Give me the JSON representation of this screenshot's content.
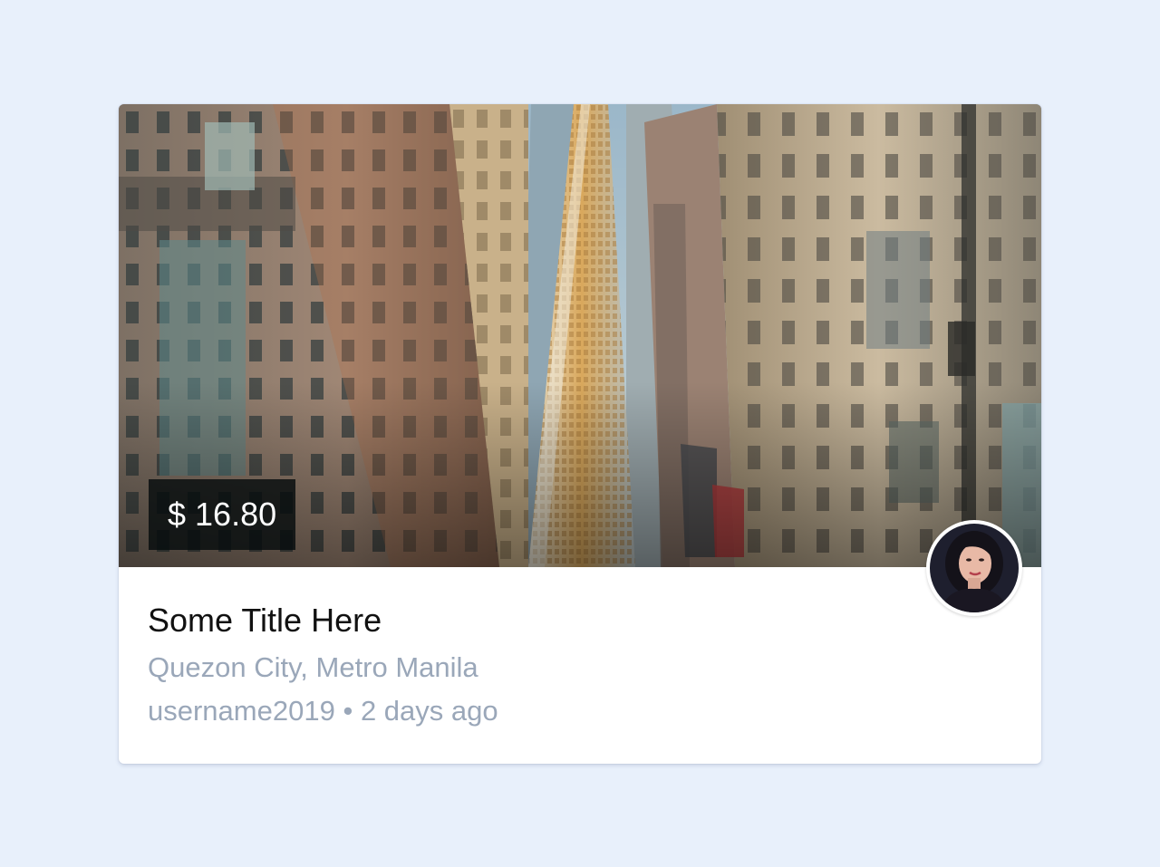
{
  "card": {
    "price": "$ 16.80",
    "title": "Some Title Here",
    "location": "Quezon City, Metro Manila",
    "username": "username2019",
    "separator": "•",
    "posted": "2 days ago"
  },
  "images": {
    "hero": "city-street-skyscraper-photo",
    "avatar": "user-avatar-photo"
  },
  "colors": {
    "page_background": "#e8f0fb",
    "card_background": "#ffffff",
    "secondary_text": "#9aa7b9",
    "price_badge_background": "#0b1214"
  }
}
